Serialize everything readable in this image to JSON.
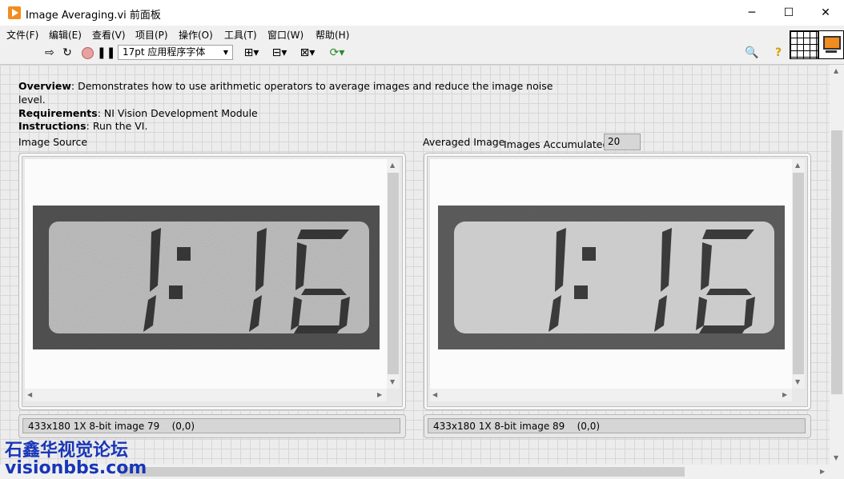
{
  "window": {
    "title": "Image Averaging.vi 前面板",
    "minimize": "─",
    "maximize": "☐",
    "close": "✕"
  },
  "menu": [
    "文件(F)",
    "编辑(E)",
    "查看(V)",
    "项目(P)",
    "操作(O)",
    "工具(T)",
    "窗口(W)",
    "帮助(H)"
  ],
  "toolbar": {
    "font": "17pt 应用程序字体"
  },
  "description": {
    "overview_label": "Overview",
    "overview_text": ": Demonstrates how to use arithmetic operators to average images and reduce the image noise",
    "overview_text2": "level.",
    "requirements_label": "Requirements",
    "requirements_text": ": NI Vision Development Module",
    "instructions_label": "Instructions",
    "instructions_text": ": Run the VI."
  },
  "left_display": {
    "label": "Image Source",
    "status": "433x180 1X 8-bit image 79",
    "coords": "(0,0)",
    "digits": "1:16"
  },
  "right_display": {
    "label": "Averaged Image",
    "status": "433x180 1X 8-bit image 89",
    "coords": "(0,0)",
    "digits": "1:16"
  },
  "images_accumulated": {
    "label": "Images Accumulated",
    "value": "20"
  },
  "watermark": {
    "line1": "石鑫华视觉论坛",
    "line2": "visionbbs.com"
  },
  "colors": {
    "brand": "#f28c1e",
    "watermark": "#1836b8"
  }
}
